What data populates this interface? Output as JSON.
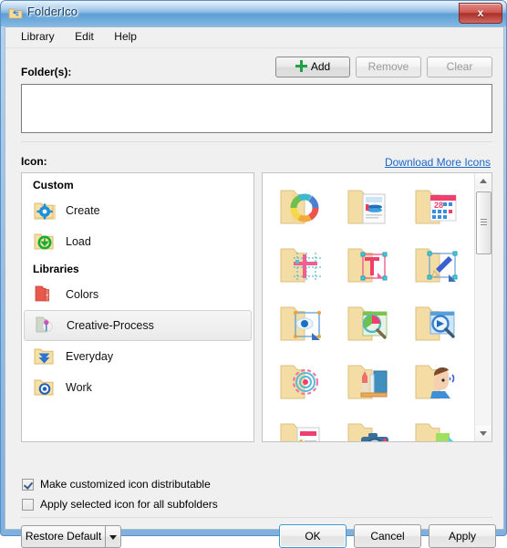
{
  "window": {
    "title": "FolderIco",
    "app_icon": "folder-app-icon",
    "close_label": "x"
  },
  "menubar": {
    "items": [
      {
        "label": "Library"
      },
      {
        "label": "Edit"
      },
      {
        "label": "Help"
      }
    ]
  },
  "folders_section": {
    "label": "Folder(s):",
    "add_label": "Add",
    "remove_label": "Remove",
    "clear_label": "Clear",
    "list_value": ""
  },
  "icon_section": {
    "label": "Icon:",
    "download_link": "Download More Icons",
    "library": {
      "groups": [
        {
          "header": "Custom",
          "items": [
            {
              "label": "Create",
              "icon": "folder-gear-icon",
              "selected": false
            },
            {
              "label": "Load",
              "icon": "folder-download-icon",
              "selected": false
            }
          ]
        },
        {
          "header": "Libraries",
          "items": [
            {
              "label": "Colors",
              "icon": "folder-red-icon",
              "selected": false
            },
            {
              "label": "Creative-Process",
              "icon": "folder-creative-icon",
              "selected": true
            },
            {
              "label": "Everyday",
              "icon": "folder-blue-arrow-icon",
              "selected": false
            },
            {
              "label": "Work",
              "icon": "folder-gear-blue-icon",
              "selected": false
            }
          ]
        }
      ]
    },
    "grid": {
      "icons": [
        {
          "name": "folder-color-wheel-icon"
        },
        {
          "name": "folder-document-design-icon"
        },
        {
          "name": "folder-calendar-icon"
        },
        {
          "name": "folder-grid-layout-icon"
        },
        {
          "name": "folder-typography-icon"
        },
        {
          "name": "folder-pen-tool-icon"
        },
        {
          "name": "folder-eye-vision-icon"
        },
        {
          "name": "folder-color-search-icon"
        },
        {
          "name": "folder-magnify-screen-icon"
        },
        {
          "name": "folder-target-icon"
        },
        {
          "name": "folder-stationery-icon"
        },
        {
          "name": "folder-listening-icon"
        },
        {
          "name": "folder-checklist-icon"
        },
        {
          "name": "folder-camera-icon"
        },
        {
          "name": "folder-shapes-icon"
        }
      ],
      "scroll_position": "near-top"
    }
  },
  "options": {
    "make_distributable": {
      "label": "Make customized icon distributable",
      "checked": true
    },
    "apply_subfolders": {
      "label": "Apply selected icon for all subfolders",
      "checked": false
    }
  },
  "footer": {
    "restore_default": "Restore Default",
    "ok": "OK",
    "cancel": "Cancel",
    "apply": "Apply"
  },
  "colors": {
    "title_text": "#123a63",
    "link": "#1b66c9",
    "accent_focus": "#3c9bd4",
    "close_red": "#ab2f29",
    "add_plus_green": "#22a14a",
    "dialog_bg": "#f0f0f0"
  }
}
